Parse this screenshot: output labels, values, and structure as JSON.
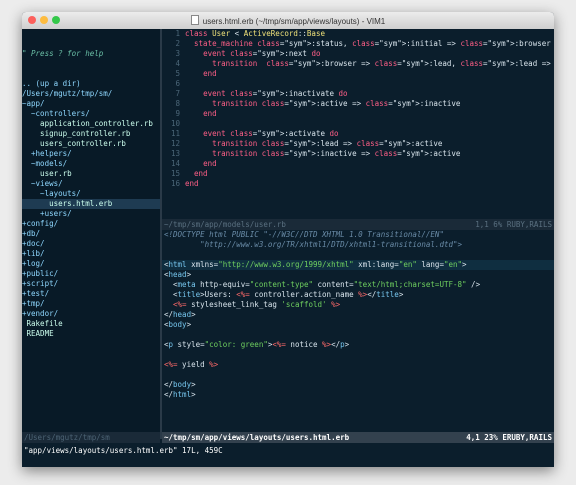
{
  "window": {
    "title": "users.html.erb (~/tmp/sm/app/views/layouts) - VIM1",
    "lights": [
      "#fc605c",
      "#fdbc40",
      "#34c84a"
    ]
  },
  "tree": {
    "help": "\" Press ? for help",
    "lines": [
      ".. (up a dir)",
      "/Users/mgutz/tmp/sm/",
      "~app/",
      "  ~controllers/",
      "    application_controller.rb",
      "    signup_controller.rb",
      "    users_controller.rb",
      "  +helpers/",
      "  ~models/",
      "    user.rb",
      "  ~views/",
      "    ~layouts/",
      "      users.html.erb",
      "    +users/",
      "+config/",
      "+db/",
      "+doc/",
      "+lib/",
      "+log/",
      "+public/",
      "+script/",
      "+test/",
      "+tmp/",
      "+vendor/",
      " Rakefile",
      " README"
    ],
    "status": "/Users/mgutz/tmp/sm"
  },
  "top_pane": {
    "line_numbers": [
      "1",
      "2",
      "3",
      "4",
      "5",
      "6",
      "7",
      "8",
      "9",
      "10",
      "11",
      "12",
      "13",
      "14",
      "15",
      "16"
    ],
    "lines": [
      "class User < ActiveRecord::Base",
      "  state_machine :status, :initial => :browser do",
      "    event :next do",
      "      transition  :browser => :lead, :lead => :active",
      "    end",
      "",
      "    event :inactivate do",
      "      transition :active => :inactive",
      "    end",
      "",
      "    event :activate do",
      "      transition :lead => :active",
      "      transition :inactive => :active",
      "    end",
      "  end",
      "end"
    ],
    "status_left": "~/tmp/sm/app/models/user.rb",
    "status_right": "1,1  6% RUBY,RAILS"
  },
  "bottom_pane": {
    "lines": [
      "<!DOCTYPE html PUBLIC \"-//W3C//DTD XHTML 1.0 Transitional//EN\"",
      "        \"http://www.w3.org/TR/xhtml1/DTD/xhtml1-transitional.dtd\">",
      "",
      "<html xmlns=\"http://www.w3.org/1999/xhtml\" xml:lang=\"en\" lang=\"en\">",
      "<head>",
      "  <meta http-equiv=\"content-type\" content=\"text/html;charset=UTF-8\" />",
      "  <title>Users: <%= controller.action_name %></title>",
      "  <%= stylesheet_link_tag 'scaffold' %>",
      "</head>",
      "<body>",
      "",
      "<p style=\"color: green\"><%= notice %></p>",
      "",
      "<%= yield %>",
      "",
      "</body>",
      "</html>"
    ],
    "status_left": "~/tmp/sm/app/views/layouts/users.html.erb",
    "status_right": "4,1  23% ERUBY,RAILS"
  },
  "cmdline": "\"app/views/layouts/users.html.erb\" 17L, 459C"
}
